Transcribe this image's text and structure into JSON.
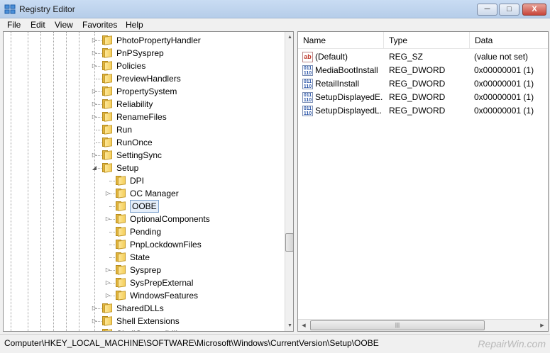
{
  "window": {
    "title": "Registry Editor",
    "min_label": "─",
    "max_label": "□",
    "close_label": "X"
  },
  "menu": [
    "File",
    "Edit",
    "View",
    "Favorites",
    "Help"
  ],
  "tree": [
    {
      "label": "PhotoPropertyHandler",
      "level": 0,
      "expander": "▷"
    },
    {
      "label": "PnPSysprep",
      "level": 0,
      "expander": "▷"
    },
    {
      "label": "Policies",
      "level": 0,
      "expander": "▷"
    },
    {
      "label": "PreviewHandlers",
      "level": 0,
      "expander": ""
    },
    {
      "label": "PropertySystem",
      "level": 0,
      "expander": "▷"
    },
    {
      "label": "Reliability",
      "level": 0,
      "expander": "▷"
    },
    {
      "label": "RenameFiles",
      "level": 0,
      "expander": "▷"
    },
    {
      "label": "Run",
      "level": 0,
      "expander": ""
    },
    {
      "label": "RunOnce",
      "level": 0,
      "expander": ""
    },
    {
      "label": "SettingSync",
      "level": 0,
      "expander": "▷"
    },
    {
      "label": "Setup",
      "level": 0,
      "expander": "◢"
    },
    {
      "label": "DPI",
      "level": 1,
      "expander": ""
    },
    {
      "label": "OC Manager",
      "level": 1,
      "expander": "▷"
    },
    {
      "label": "OOBE",
      "level": 1,
      "expander": "",
      "selected": true
    },
    {
      "label": "OptionalComponents",
      "level": 1,
      "expander": "▷"
    },
    {
      "label": "Pending",
      "level": 1,
      "expander": ""
    },
    {
      "label": "PnpLockdownFiles",
      "level": 1,
      "expander": ""
    },
    {
      "label": "State",
      "level": 1,
      "expander": ""
    },
    {
      "label": "Sysprep",
      "level": 1,
      "expander": "▷"
    },
    {
      "label": "SysPrepExternal",
      "level": 1,
      "expander": "▷"
    },
    {
      "label": "WindowsFeatures",
      "level": 1,
      "expander": "▷"
    },
    {
      "label": "SharedDLLs",
      "level": 0,
      "expander": "▷"
    },
    {
      "label": "Shell Extensions",
      "level": 0,
      "expander": "▷"
    },
    {
      "label": "ShellCompatibility",
      "level": 0,
      "expander": "▷"
    }
  ],
  "list": {
    "columns": [
      "Name",
      "Type",
      "Data"
    ],
    "rows": [
      {
        "icon": "string-value-icon",
        "icon_text": "ab",
        "name": "(Default)",
        "type": "REG_SZ",
        "data": "(value not set)"
      },
      {
        "icon": "dword-value-icon",
        "icon_text": "011\n110",
        "name": "MediaBootInstall",
        "type": "REG_DWORD",
        "data": "0x00000001 (1)"
      },
      {
        "icon": "dword-value-icon",
        "icon_text": "011\n110",
        "name": "RetailInstall",
        "type": "REG_DWORD",
        "data": "0x00000001 (1)"
      },
      {
        "icon": "dword-value-icon",
        "icon_text": "011\n110",
        "name": "SetupDisplayedE...",
        "type": "REG_DWORD",
        "data": "0x00000001 (1)"
      },
      {
        "icon": "dword-value-icon",
        "icon_text": "011\n110",
        "name": "SetupDisplayedL...",
        "type": "REG_DWORD",
        "data": "0x00000001 (1)"
      }
    ]
  },
  "status": {
    "path": "Computer\\HKEY_LOCAL_MACHINE\\SOFTWARE\\Microsoft\\Windows\\CurrentVersion\\Setup\\OOBE"
  },
  "watermark": "RepairWin.com"
}
